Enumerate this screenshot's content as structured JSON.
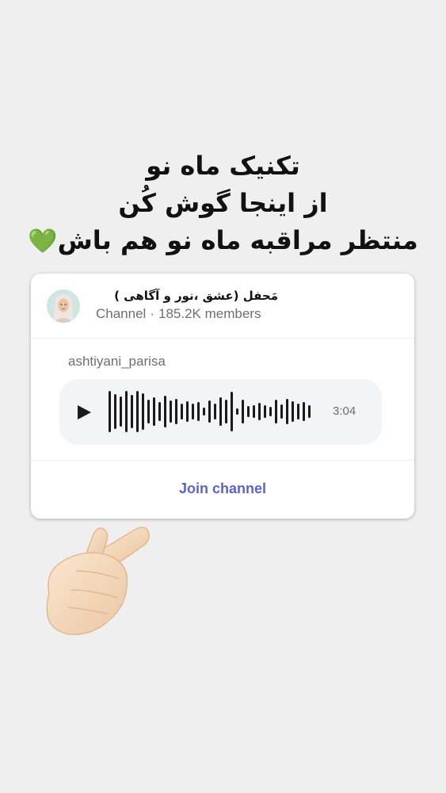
{
  "headline": {
    "line1": "تکنیک ماه نو",
    "line2": "از اینجا گوش کُن",
    "line3": "منتظر مراقبه ماه نو هم باش",
    "heart_emoji": "💚"
  },
  "card": {
    "channel_name": "مَحفل   (عشق ،نور و آگاهی  )",
    "channel_type": "Channel",
    "separator": "·",
    "members": "185.2K members",
    "author": "ashtiyani_parisa",
    "audio": {
      "duration": "3:04",
      "play_icon": "play-icon"
    },
    "join_label": "Join channel"
  },
  "colors": {
    "background": "#efefef",
    "join_link": "#5a63cf",
    "audio_bg": "#f3f4f6",
    "heart": "#3ec73e"
  }
}
